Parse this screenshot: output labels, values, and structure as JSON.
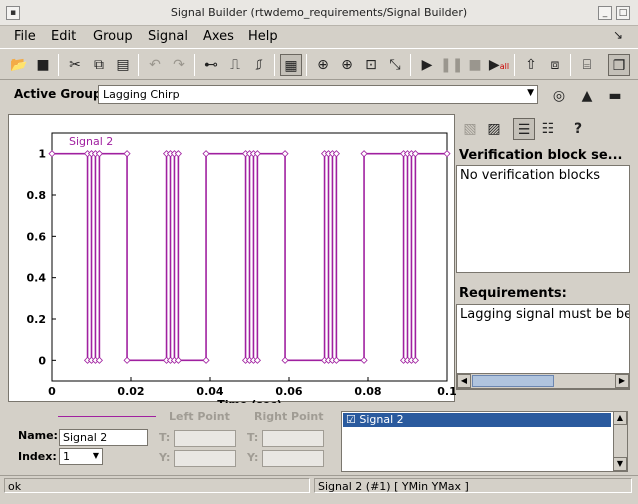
{
  "window": {
    "title": "Signal Builder (rtwdemo_requirements/Signal Builder)"
  },
  "menu": [
    "File",
    "Edit",
    "Group",
    "Signal",
    "Axes",
    "Help"
  ],
  "group": {
    "label": "Active Group:",
    "value": "Lagging Chirp"
  },
  "verification": {
    "header": "Verification block se...",
    "text": "No verification blocks"
  },
  "requirements": {
    "header": "Requirements:",
    "text": "Lagging signal must be be"
  },
  "signal_props": {
    "name_label": "Name:",
    "name_value": "Signal 2",
    "index_label": "Index:",
    "index_value": "1",
    "left_point": "Left Point",
    "right_point": "Right Point",
    "t_label": "T:",
    "y_label": "Y:"
  },
  "signal_list": {
    "items": [
      "Signal 2"
    ]
  },
  "status": {
    "left": "ok",
    "right": "Signal 2 (#1)  [ YMin YMax ]"
  },
  "chart_data": {
    "type": "line",
    "series": [
      {
        "name": "Signal 2",
        "color": "#a020a0",
        "x": [
          0,
          0.009,
          0.009,
          0.01,
          0.01,
          0.011,
          0.011,
          0.012,
          0.012,
          0.019,
          0.019,
          0.029,
          0.029,
          0.03,
          0.03,
          0.031,
          0.031,
          0.032,
          0.032,
          0.039,
          0.039,
          0.049,
          0.049,
          0.05,
          0.05,
          0.051,
          0.051,
          0.052,
          0.052,
          0.059,
          0.059,
          0.069,
          0.069,
          0.07,
          0.07,
          0.071,
          0.071,
          0.072,
          0.072,
          0.079,
          0.079,
          0.089,
          0.089,
          0.09,
          0.09,
          0.091,
          0.091,
          0.092,
          0.092,
          0.1
        ],
        "y": [
          1,
          1,
          0,
          0,
          1,
          1,
          0,
          0,
          1,
          1,
          0,
          0,
          1,
          1,
          0,
          0,
          1,
          1,
          0,
          0,
          1,
          1,
          0,
          0,
          1,
          1,
          0,
          0,
          1,
          1,
          0,
          0,
          1,
          1,
          0,
          0,
          1,
          1,
          0,
          0,
          1,
          1,
          0,
          0,
          1,
          1,
          0,
          0,
          1,
          1
        ]
      }
    ],
    "xlabel": "Time (sec)",
    "xlim": [
      0,
      0.1
    ],
    "ylim": [
      -0.1,
      1.1
    ],
    "xticks": [
      "0",
      "0.02",
      "0.04",
      "0.06",
      "0.08",
      "0.1"
    ],
    "yticks": [
      "0",
      "0.2",
      "0.4",
      "0.6",
      "0.8",
      "1"
    ],
    "grid": false
  }
}
